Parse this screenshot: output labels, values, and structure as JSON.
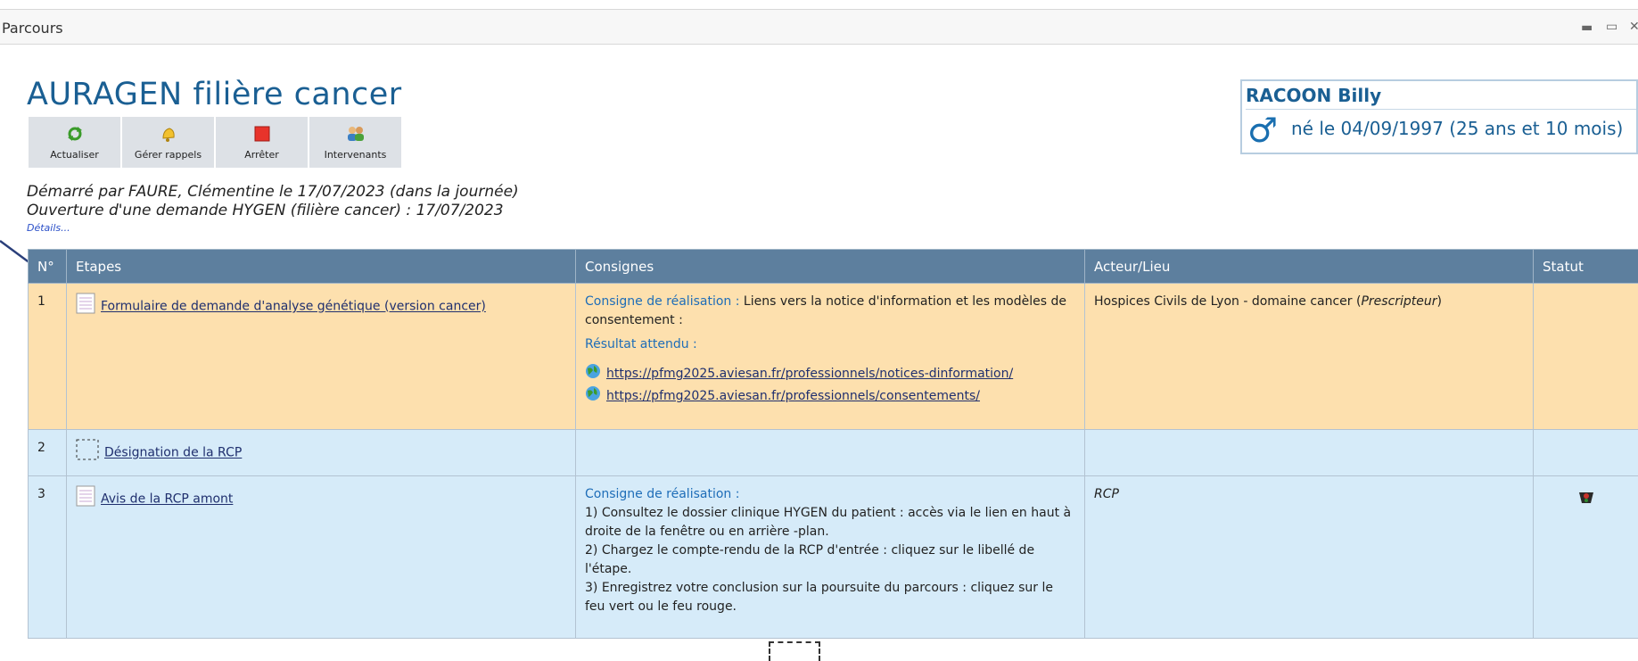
{
  "window": {
    "title": "Parcours",
    "controls": [
      "▬",
      "▭",
      "✕"
    ]
  },
  "page": {
    "title": "AURAGEN filière cancer"
  },
  "toolbar": [
    {
      "label": "Actualiser",
      "icon": "refresh-icon"
    },
    {
      "label": "Gérer rappels",
      "icon": "bell-icon"
    },
    {
      "label": "Arrêter",
      "icon": "stop-icon"
    },
    {
      "label": "Intervenants",
      "icon": "users-icon"
    }
  ],
  "patient": {
    "name": "RACOON Billy",
    "gender_symbol": "♂",
    "birth": "né le 04/09/1997 (25 ans et 10 mois)"
  },
  "info": {
    "started": "Démarré par FAURE, Clémentine le 17/07/2023 (dans la journée)",
    "opening": "Ouverture d'une demande HYGEN (filière cancer) : 17/07/2023",
    "details": "Détails..."
  },
  "table": {
    "headers": {
      "num": "N°",
      "steps": "Etapes",
      "instructions": "Consignes",
      "actor": "Acteur/Lieu",
      "status": "Statut"
    },
    "rows": [
      {
        "num": "1",
        "step": "Formulaire de demande d'analyse génétique (version cancer)",
        "instr_label": "Consigne de réalisation :",
        "instr_text": "Liens vers la notice d'information et les modèles de consentement :",
        "expected_label": "Résultat attendu :",
        "links": [
          "https://pfmg2025.aviesan.fr/professionnels/notices-dinformation/",
          "https://pfmg2025.aviesan.fr/professionnels/consentements/"
        ],
        "actor": "Hospices Civils de Lyon - domaine cancer",
        "actor_role": "Prescripteur"
      },
      {
        "num": "2",
        "step": "Désignation de la RCP"
      },
      {
        "num": "3",
        "step": "Avis de la RCP amont",
        "instr_label": "Consigne de réalisation :",
        "instr_lines": [
          "1) Consultez le dossier clinique HYGEN du patient : accès via le lien en haut à droite de la fenêtre ou en arrière -plan.",
          "2) Chargez le compte-rendu de la RCP d'entrée : cliquez sur le libellé de l'étape.",
          "3) Enregistrez votre conclusion sur la poursuite du parcours : cliquez sur le feu vert ou le feu rouge."
        ],
        "actor": "RCP",
        "status_icon": "traffic-light-icon"
      }
    ]
  }
}
